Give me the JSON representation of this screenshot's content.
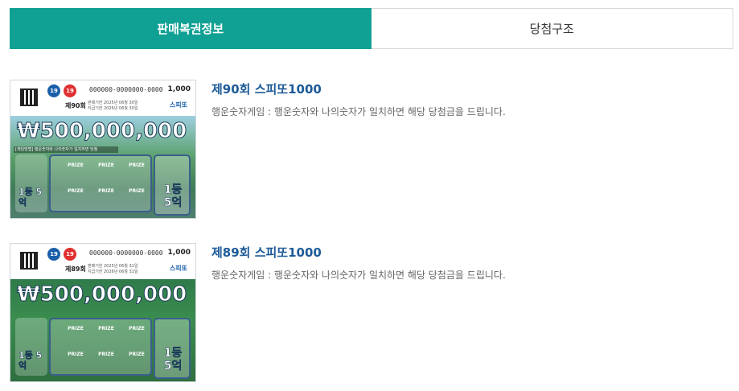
{
  "tabs": [
    {
      "label": "판매복권정보",
      "active": true
    },
    {
      "label": "당첨구조",
      "active": false
    }
  ],
  "colors": {
    "accent": "#11a194",
    "title": "#1d5a98",
    "desc": "#666666"
  },
  "items": [
    {
      "title": "제90회 스피또1000",
      "description": "행운숫자게임 : 행운숫자와 나의숫자가 일치하면 해당 당첨금을 드립니다.",
      "ticket": {
        "serial": "000000-0000000-0000",
        "price": "1,000",
        "round": "제90회",
        "dates": [
          "판매기한 2025년 06월 30일",
          "지급기한 2026년 06월 30일"
        ],
        "brand": "스피또",
        "amount": "₩500,000,000",
        "strip": "[게임방법] 행운숫자와 나의숫자가 일치하면 당첨",
        "left_prize": "1등 5억",
        "right_prize": "1등 5억",
        "prize_label": "PRIZE"
      }
    },
    {
      "title": "제89회 스피또1000",
      "description": "행운숫자게임 : 행운숫자와 나의숫자가 일치하면 해당 당첨금을 드립니다.",
      "ticket": {
        "serial": "000000-0000000-0000",
        "price": "1,000",
        "round": "제89회",
        "dates": [
          "판매기한 2025년 06월 31일",
          "지급기한 2026년 06월 31일"
        ],
        "brand": "스피또",
        "amount": "₩500,000,000",
        "strip": "",
        "left_prize": "1등 5억",
        "right_prize": "1등 5억",
        "prize_label": "PRIZE"
      }
    }
  ]
}
